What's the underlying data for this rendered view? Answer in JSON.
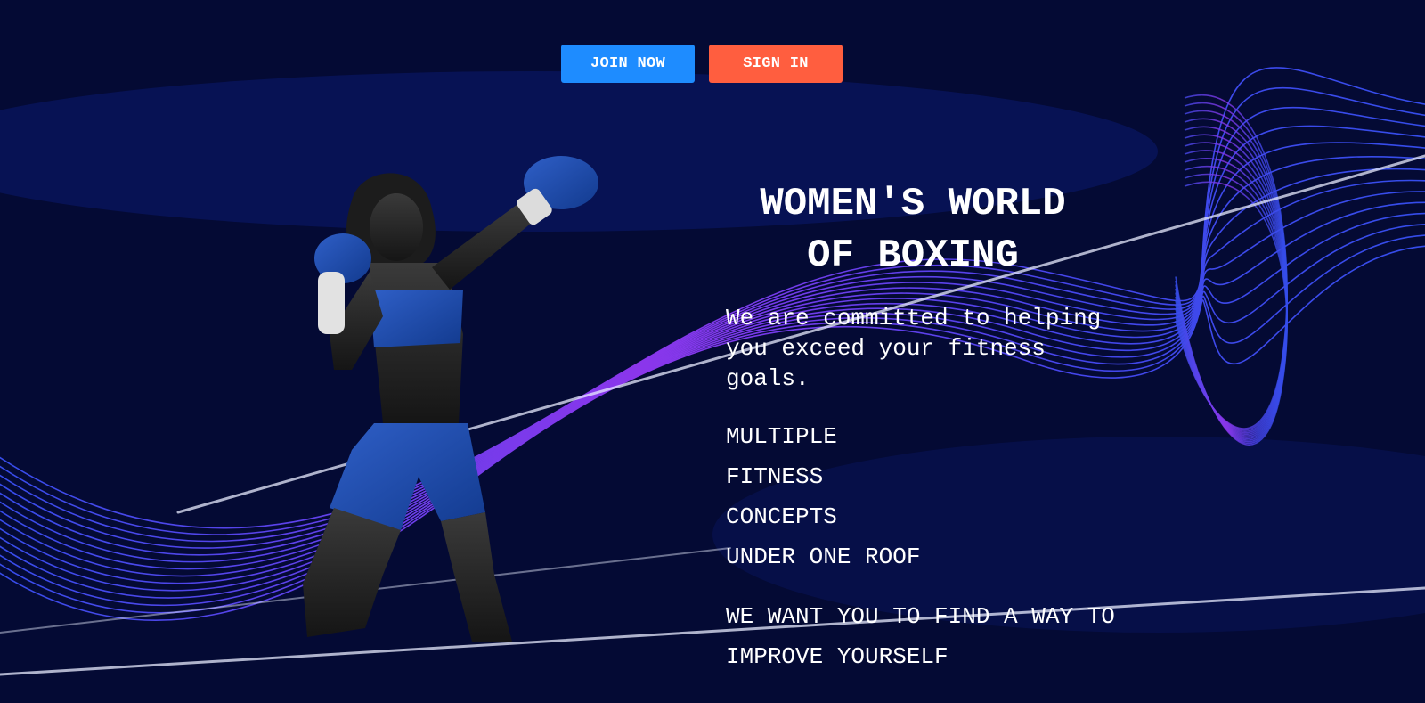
{
  "buttons": {
    "join": "JOIN NOW",
    "sign_in": "SIGN IN"
  },
  "colors": {
    "background": "#040a34",
    "join_button": "#1e8cff",
    "sign_in_button": "#ff5e3f",
    "wave_blue": "#3a55ff",
    "wave_purple": "#9a3bff"
  },
  "hero": {
    "title_line1": "WOMEN'S WORLD",
    "title_line2": "OF BOXING",
    "lead": "We are committed to helping you exceed your fitness goals.",
    "features": [
      "MULTIPLE",
      "FITNESS",
      "CONCEPTS",
      "UNDER ONE ROOF"
    ],
    "tagline": "WE WANT YOU TO FIND A WAY TO IMPROVE YOURSELF"
  },
  "images": {
    "hero_image": "boxer-silhouette"
  }
}
